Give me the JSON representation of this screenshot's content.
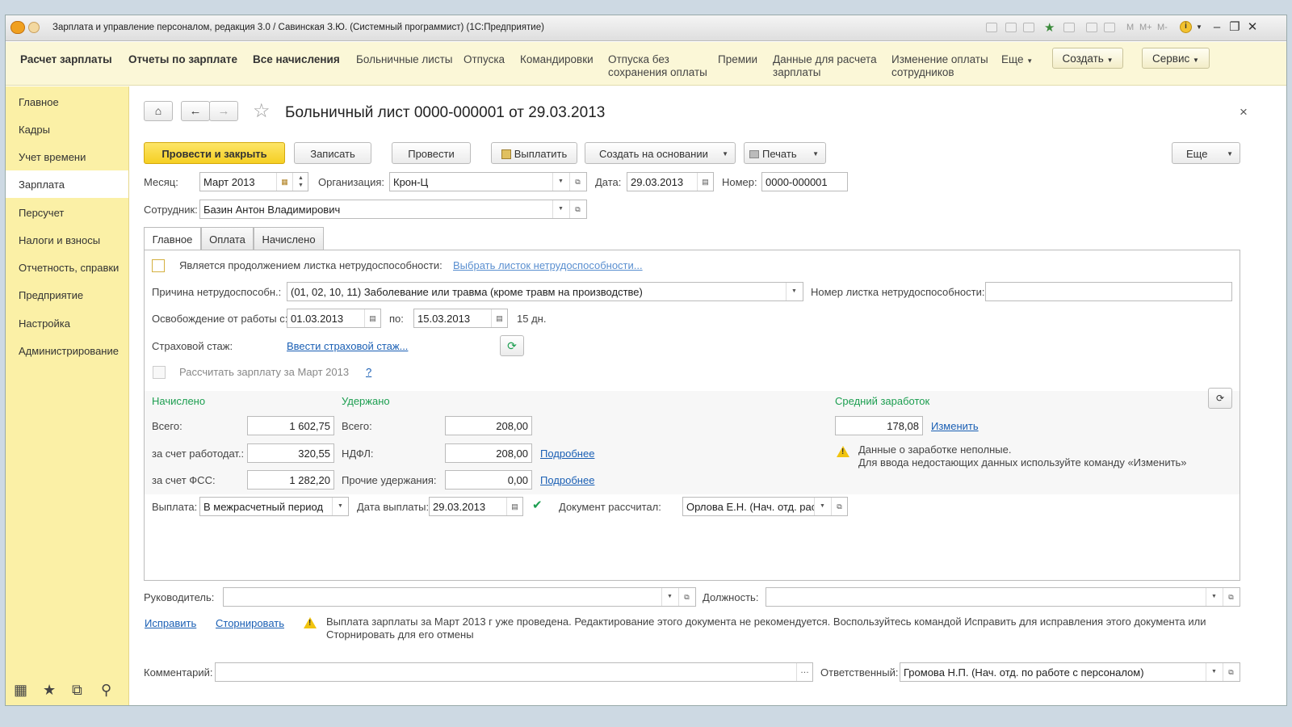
{
  "window": {
    "title": "Зарплата и управление персоналом, редакция 3.0 / Савинская З.Ю. (Системный программист)  (1С:Предприятие)"
  },
  "menu": {
    "items": [
      "Расчет зарплаты",
      "Отчеты по зарплате",
      "Все начисления",
      "Больничные листы",
      "Отпуска",
      "Командировки",
      "Отпуска без сохранения оплаты",
      "Премии",
      "Данные для расчета зарплаты",
      "Изменение оплаты сотрудников",
      "Еще"
    ],
    "create_label": "Создать",
    "service_label": "Сервис"
  },
  "sidebar": {
    "items": [
      "Главное",
      "Кадры",
      "Учет времени",
      "Зарплата",
      "Персучет",
      "Налоги и взносы",
      "Отчетность, справки",
      "Предприятие",
      "Настройка",
      "Администрирование"
    ],
    "active": "Зарплата"
  },
  "document": {
    "title": "Больничный лист 0000-000001 от 29.03.2013",
    "close": "×"
  },
  "toolbar": {
    "post_close": "Провести и закрыть",
    "save": "Записать",
    "post": "Провести",
    "pay": "Выплатить",
    "create_based": "Создать на основании",
    "print": "Печать",
    "more": "Еще"
  },
  "header_fields": {
    "month_label": "Месяц:",
    "month_value": "Март 2013",
    "org_label": "Организация:",
    "org_value": "Крон-Ц",
    "date_label": "Дата:",
    "date_value": "29.03.2013",
    "number_label": "Номер:",
    "number_value": "0000-000001",
    "employee_label": "Сотрудник:",
    "employee_value": "Базин Антон Владимирович"
  },
  "tabs": [
    "Главное",
    "Оплата",
    "Начислено"
  ],
  "main_tab": {
    "continuation_label": "Является продолжением листка нетрудоспособности:",
    "choose_sheet_link": "Выбрать листок нетрудоспособности...",
    "reason_label": "Причина нетрудоспособн.:",
    "reason_value": "(01, 02, 10, 11) Заболевание или травма (кроме травм на производстве)",
    "sheet_number_label": "Номер листка нетрудоспособности:",
    "sheet_number_value": "",
    "release_from_label": "Освобождение от работы с:",
    "release_from_value": "01.03.2013",
    "release_to_label": "по:",
    "release_to_value": "15.03.2013",
    "days_text": "15 дн.",
    "insurance_label": "Страховой стаж:",
    "insurance_link": "Ввести страховой стаж...",
    "calc_salary_label": "Рассчитать зарплату за Март 2013",
    "help": "?"
  },
  "accrued": {
    "header": "Начислено",
    "total_label": "Всего:",
    "total_value": "1 602,75",
    "employer_label": "за счет работодат.:",
    "employer_value": "320,55",
    "fss_label": "за счет ФСС:",
    "fss_value": "1 282,20"
  },
  "withheld": {
    "header": "Удержано",
    "total_label": "Всего:",
    "total_value": "208,00",
    "ndfl_label": "НДФЛ:",
    "ndfl_value": "208,00",
    "ndfl_link": "Подробнее",
    "other_label": "Прочие удержания:",
    "other_value": "0,00",
    "other_link": "Подробнее"
  },
  "average": {
    "header": "Средний заработок",
    "value": "178,08",
    "change_link": "Изменить",
    "warn_line1": "Данные о заработке неполные.",
    "warn_line2": "Для ввода недостающих данных используйте команду «Изменить»"
  },
  "payment": {
    "label": "Выплата:",
    "value": "В межрасчетный период",
    "date_label": "Дата выплаты:",
    "date_value": "29.03.2013",
    "calculated_label": "Документ рассчитал:",
    "calculated_value": "Орлова Е.Н. (Нач. отд. рас"
  },
  "footer": {
    "manager_label": "Руководитель:",
    "manager_value": "",
    "position_label": "Должность:",
    "position_value": "",
    "fix_link": "Исправить",
    "reverse_link": "Сторнировать",
    "warn_line1": "Выплата зарплаты за Март 2013 г уже проведена. Редактирование этого документа не рекомендуется. Воспользуйтесь командой Исправить для исправления этого документа или",
    "warn_line2": "Сторнировать для его отмены",
    "comment_label": "Комментарий:",
    "comment_value": "",
    "responsible_label": "Ответственный:",
    "responsible_value": "Громова Н.П. (Нач. отд. по работе с персоналом)"
  },
  "colors": {
    "accent_yellow": "#f5cf23",
    "sidebar_bg": "#fbf0a6",
    "menubar_bg": "#fbf7d7",
    "green_header": "#1c9e50",
    "link_blue": "#1a5fb4"
  }
}
